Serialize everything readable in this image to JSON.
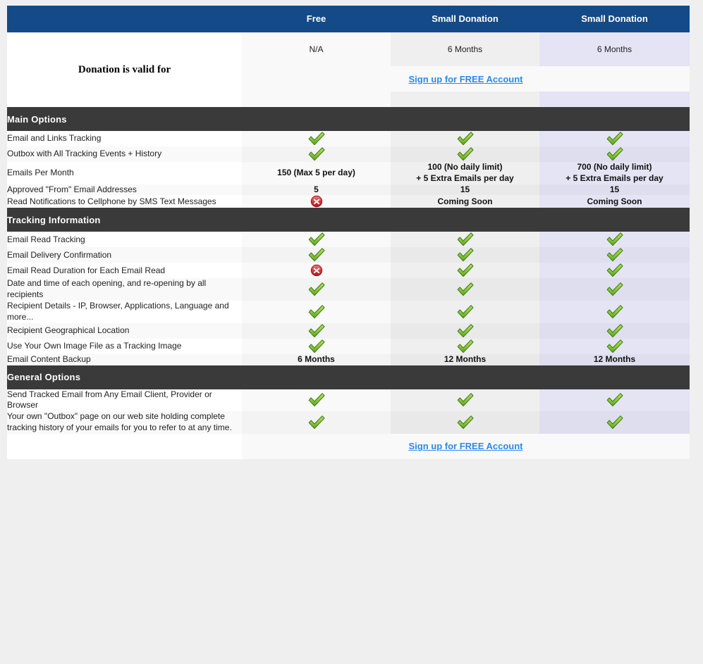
{
  "columns": {
    "label_header": "",
    "plans": [
      "Free",
      "Small Donation",
      "Small Donation"
    ]
  },
  "validity": {
    "label": "Donation is valid for",
    "values": [
      "N/A",
      "6 Months",
      "6 Months"
    ]
  },
  "signup": {
    "label": "Sign up for FREE Account"
  },
  "colors": {
    "header_blue": "#134a87",
    "section_dark": "#3a3a3a",
    "link_blue": "#2a8aea",
    "check_green": "#76b82a",
    "cross_red": "#d6393c",
    "col_free": "#f9f9f9",
    "col_sd1": "#efefef",
    "col_sd2": "#e4e4f5"
  },
  "sections": [
    {
      "title": "Main Options",
      "rows": [
        {
          "label": "Email and Links Tracking",
          "values": [
            {
              "type": "check"
            },
            {
              "type": "check"
            },
            {
              "type": "check"
            }
          ]
        },
        {
          "label": "Outbox with All Tracking Events + History",
          "values": [
            {
              "type": "check"
            },
            {
              "type": "check"
            },
            {
              "type": "check"
            }
          ]
        },
        {
          "label": "Emails Per Month",
          "values": [
            {
              "type": "text",
              "text": "150 (Max 5 per day)"
            },
            {
              "type": "text",
              "text": "100 (No daily limit)\n+ 5 Extra Emails per day"
            },
            {
              "type": "text",
              "text": "700 (No daily limit)\n+ 5 Extra Emails per day"
            }
          ]
        },
        {
          "label": "Approved \"From\" Email Addresses",
          "values": [
            {
              "type": "text",
              "text": "5"
            },
            {
              "type": "text",
              "text": "15"
            },
            {
              "type": "text",
              "text": "15"
            }
          ]
        },
        {
          "label": "Read Notifications to Cellphone by SMS Text Messages",
          "values": [
            {
              "type": "cross"
            },
            {
              "type": "text",
              "text": "Coming Soon"
            },
            {
              "type": "text",
              "text": "Coming Soon"
            }
          ]
        }
      ]
    },
    {
      "title": "Tracking Information",
      "rows": [
        {
          "label": "Email Read Tracking",
          "values": [
            {
              "type": "check"
            },
            {
              "type": "check"
            },
            {
              "type": "check"
            }
          ]
        },
        {
          "label": "Email Delivery Confirmation",
          "values": [
            {
              "type": "check"
            },
            {
              "type": "check"
            },
            {
              "type": "check"
            }
          ]
        },
        {
          "label": "Email Read Duration for Each Email Read",
          "values": [
            {
              "type": "cross"
            },
            {
              "type": "check"
            },
            {
              "type": "check"
            }
          ]
        },
        {
          "label": "Date and time of each opening, and re-opening by all recipients",
          "values": [
            {
              "type": "check"
            },
            {
              "type": "check"
            },
            {
              "type": "check"
            }
          ]
        },
        {
          "label": "Recipient Details - IP, Browser, Applications, Language and more...",
          "values": [
            {
              "type": "check"
            },
            {
              "type": "check"
            },
            {
              "type": "check"
            }
          ]
        },
        {
          "label": "Recipient Geographical Location",
          "values": [
            {
              "type": "check"
            },
            {
              "type": "check"
            },
            {
              "type": "check"
            }
          ]
        },
        {
          "label": "Use Your Own Image File as a Tracking Image",
          "values": [
            {
              "type": "check"
            },
            {
              "type": "check"
            },
            {
              "type": "check"
            }
          ]
        },
        {
          "label": "Email Content Backup",
          "values": [
            {
              "type": "text",
              "text": "6 Months"
            },
            {
              "type": "text",
              "text": "12 Months"
            },
            {
              "type": "text",
              "text": "12 Months"
            }
          ]
        }
      ]
    },
    {
      "title": "General Options",
      "rows": [
        {
          "label": "Send Tracked Email from Any Email Client, Provider or Browser",
          "values": [
            {
              "type": "check"
            },
            {
              "type": "check"
            },
            {
              "type": "check"
            }
          ]
        },
        {
          "label": "Your own \"Outbox\" page on our web site holding complete tracking history of your emails for you to refer to at any time.",
          "values": [
            {
              "type": "check"
            },
            {
              "type": "check"
            },
            {
              "type": "check"
            }
          ]
        }
      ]
    }
  ]
}
